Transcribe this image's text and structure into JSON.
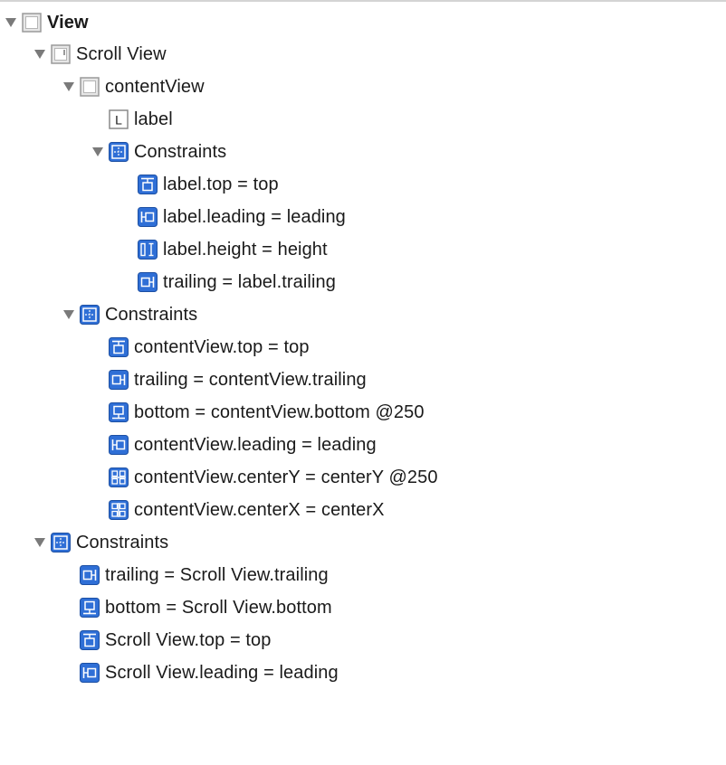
{
  "outline": {
    "root": {
      "label": "View",
      "icon": "view-icon",
      "expanded": true
    },
    "scroll_view": {
      "label": "Scroll View",
      "icon": "scroll-view-icon",
      "expanded": true
    },
    "content_view": {
      "label": "contentView",
      "icon": "view-icon",
      "expanded": true
    },
    "label_item": {
      "label": "label",
      "icon": "label-icon",
      "glyph": "L"
    },
    "content_constraints": {
      "label": "Constraints",
      "icon": "constraints-group-icon",
      "expanded": true,
      "items": [
        {
          "label": "label.top = top",
          "icon": "top-constraint-icon"
        },
        {
          "label": "label.leading = leading",
          "icon": "leading-constraint-icon"
        },
        {
          "label": "label.height = height",
          "icon": "height-constraint-icon"
        },
        {
          "label": "trailing = label.trailing",
          "icon": "trailing-constraint-icon"
        }
      ]
    },
    "scroll_constraints": {
      "label": "Constraints",
      "icon": "constraints-group-icon",
      "expanded": true,
      "items": [
        {
          "label": "contentView.top = top",
          "icon": "top-constraint-icon"
        },
        {
          "label": "trailing = contentView.trailing",
          "icon": "trailing-constraint-icon"
        },
        {
          "label": "bottom = contentView.bottom @250",
          "icon": "bottom-constraint-icon"
        },
        {
          "label": "contentView.leading = leading",
          "icon": "leading-constraint-icon"
        },
        {
          "label": "contentView.centerY = centerY @250",
          "icon": "center-y-constraint-icon"
        },
        {
          "label": "contentView.centerX = centerX",
          "icon": "center-x-constraint-icon"
        }
      ]
    },
    "view_constraints": {
      "label": "Constraints",
      "icon": "constraints-group-icon",
      "expanded": true,
      "items": [
        {
          "label": "trailing = Scroll View.trailing",
          "icon": "trailing-constraint-icon"
        },
        {
          "label": "bottom = Scroll View.bottom",
          "icon": "bottom-constraint-icon"
        },
        {
          "label": "Scroll View.top = top",
          "icon": "top-constraint-icon"
        },
        {
          "label": "Scroll View.leading = leading",
          "icon": "leading-constraint-icon"
        }
      ]
    }
  },
  "colors": {
    "constraint_blue": "#2f6fd6",
    "constraint_blue_dark": "#1c4fa3",
    "disclosure": "#7a7a7a",
    "view_border": "#9a9a9a",
    "view_fill": "#e6e6e6"
  }
}
